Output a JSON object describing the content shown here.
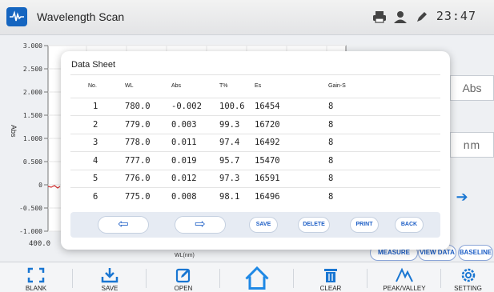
{
  "app": {
    "title": "Wavelength Scan",
    "time": "23:47"
  },
  "chart": {
    "y_axis_label": "Abs",
    "x_axis_label": "WL(nm)",
    "y_ticks": [
      "3.000",
      "2.500",
      "2.000",
      "1.500",
      "1.000",
      "0.500",
      "0",
      "-0.500",
      "-1.000"
    ],
    "x_start": "400.0"
  },
  "side": {
    "mode_value": "Abs",
    "unit_value": "nm",
    "buttons": {
      "measure": "MEASURE",
      "view_data": "VIEW DATA",
      "baseline": "BASELINE"
    }
  },
  "dialog": {
    "title": "Data Sheet",
    "columns": [
      "No.",
      "WL",
      "Abs",
      "T%",
      "Es",
      "Gain-S"
    ],
    "rows": [
      [
        "1",
        "780.0",
        "-0.002",
        "100.6",
        "16454",
        "8"
      ],
      [
        "2",
        "779.0",
        "0.003",
        "99.3",
        "16720",
        "8"
      ],
      [
        "3",
        "778.0",
        "0.011",
        "97.4",
        "16492",
        "8"
      ],
      [
        "4",
        "777.0",
        "0.019",
        "95.7",
        "15470",
        "8"
      ],
      [
        "5",
        "776.0",
        "0.012",
        "97.3",
        "16591",
        "8"
      ],
      [
        "6",
        "775.0",
        "0.008",
        "98.1",
        "16496",
        "8"
      ]
    ],
    "buttons": {
      "prev": "⇦",
      "next": "⇨",
      "save": "SAVE",
      "delete": "DELETE",
      "print": "PRINT",
      "back": "BACK"
    }
  },
  "toolbar": {
    "items": [
      {
        "label": "BLANK",
        "icon": "blank-icon"
      },
      {
        "label": "SAVE",
        "icon": "download-icon"
      },
      {
        "label": "OPEN",
        "icon": "edit-icon"
      },
      {
        "label": "",
        "icon": "home-icon"
      },
      {
        "label": "CLEAR",
        "icon": "trash-icon"
      },
      {
        "label": "PEAK/VALLEY",
        "icon": "peak-valley-icon"
      },
      {
        "label": "SETTING",
        "icon": "gear-icon"
      }
    ]
  },
  "colors": {
    "accent": "#1976d2",
    "curve": "#d32f2f"
  }
}
